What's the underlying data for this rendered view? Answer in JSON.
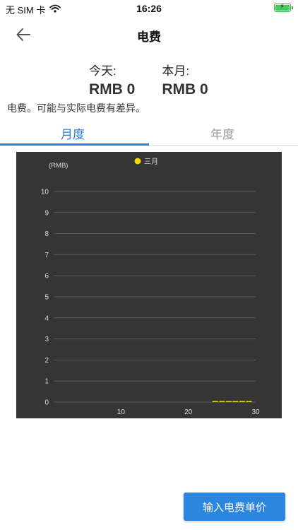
{
  "status_bar": {
    "carrier": "无 SIM 卡",
    "time": "16:26",
    "wifi_icon": "wifi-icon",
    "battery_icon": "battery-charging-icon"
  },
  "nav": {
    "back_icon": "back-arrow-icon",
    "title": "电费"
  },
  "summary": {
    "today_label": "今天:",
    "today_value": "RMB 0",
    "month_label": "本月:",
    "month_value": "RMB 0"
  },
  "note": "电费。可能与实际电费有差异。",
  "tabs": [
    {
      "label": "月度",
      "active": true
    },
    {
      "label": "年度",
      "active": false
    }
  ],
  "colors": {
    "accent": "#2b7fd6",
    "chart_bg": "#353535",
    "series": "#f5d800"
  },
  "chart_data": {
    "type": "bar",
    "ylabel": "(RMB)",
    "ylim": [
      0,
      10
    ],
    "y_ticks": [
      0,
      1,
      2,
      3,
      4,
      5,
      6,
      7,
      8,
      9,
      10
    ],
    "xlim": [
      0,
      30
    ],
    "x_ticks": [
      10,
      20,
      30
    ],
    "grid": true,
    "legend_position": "top-center",
    "series": [
      {
        "name": "三月",
        "color": "#f5d800",
        "x": [
          24,
          25,
          26,
          27,
          28,
          29
        ],
        "values": [
          0.02,
          0.05,
          0.05,
          0.05,
          0.05,
          0.02
        ]
      }
    ]
  },
  "action_button": "输入电费单价"
}
